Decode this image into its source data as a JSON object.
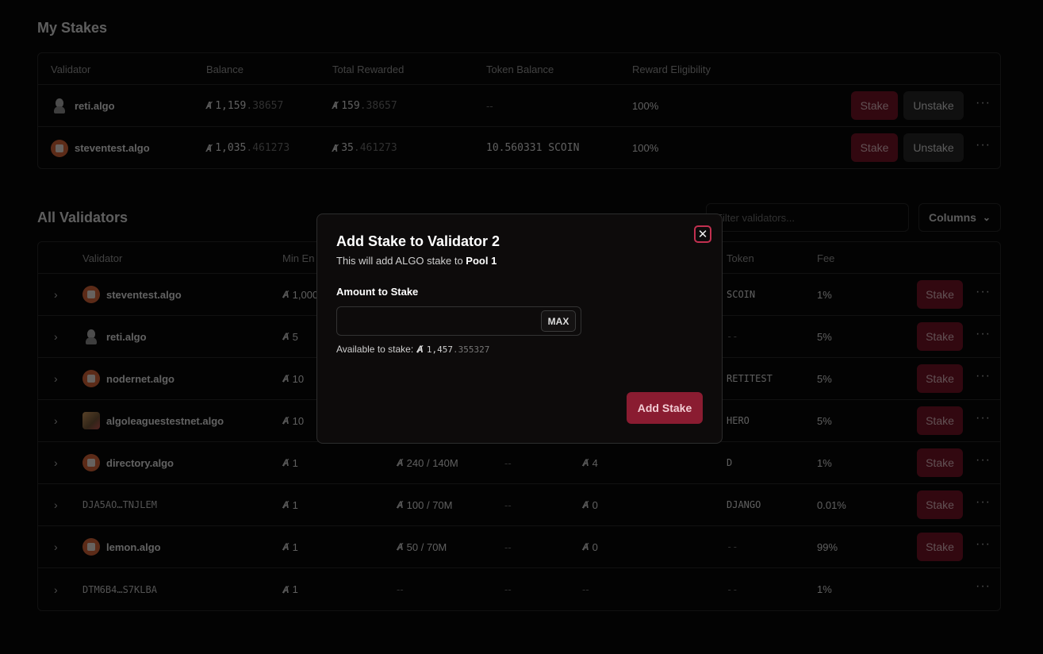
{
  "my_stakes": {
    "title": "My Stakes",
    "headers": [
      "Validator",
      "Balance",
      "Total Rewarded",
      "Token Balance",
      "Reward Eligibility"
    ],
    "rows": [
      {
        "validator": "reti.algo",
        "balance_int": "1,159",
        "balance_dec": ".38657",
        "rewarded_int": "159",
        "rewarded_dec": ".38657",
        "token_balance": "--",
        "eligibility": "100%",
        "stake_label": "Stake",
        "unstake_label": "Unstake",
        "more": "···"
      },
      {
        "validator": "steventest.algo",
        "balance_int": "1,035",
        "balance_dec": ".461273",
        "rewarded_int": "35",
        "rewarded_dec": ".461273",
        "token_balance": "10.560331 SCOIN",
        "eligibility": "100%",
        "stake_label": "Stake",
        "unstake_label": "Unstake",
        "more": "···"
      }
    ]
  },
  "all_validators": {
    "title": "All Validators",
    "filter_placeholder": "Filter validators...",
    "columns_label": "Columns",
    "headers": {
      "validator": "Validator",
      "min_entry": "Min En",
      "token": "Token",
      "fee": "Fee"
    },
    "rows": [
      {
        "validator": "steventest.algo",
        "min": "1,000",
        "stakers": "",
        "pools": "",
        "reward": "",
        "token": "SCOIN",
        "fee": "1%",
        "stake": "Stake"
      },
      {
        "validator": "reti.algo",
        "min": "5",
        "stakers": "",
        "pools": "",
        "reward": "",
        "token": "--",
        "fee": "5%",
        "stake": "Stake"
      },
      {
        "validator": "nodernet.algo",
        "min": "10",
        "stakers": "",
        "pools": "",
        "reward": "",
        "token": "RETITEST",
        "fee": "5%",
        "stake": "Stake"
      },
      {
        "validator": "algoleaguestestnet.algo",
        "min": "10",
        "stakers": "",
        "pools": "",
        "reward": "",
        "token": "HERO",
        "fee": "5%",
        "stake": "Stake"
      },
      {
        "validator": "directory.algo",
        "min": "1",
        "stakers": "240 / 140M",
        "pools": "--",
        "reward": "4",
        "token": "D",
        "fee": "1%",
        "stake": "Stake"
      },
      {
        "validator": "DJA5AO…TNJLEM",
        "min": "1",
        "stakers": "100 / 70M",
        "pools": "--",
        "reward": "0",
        "token": "DJANGO",
        "fee": "0.01%",
        "stake": "Stake"
      },
      {
        "validator": "lemon.algo",
        "min": "1",
        "stakers": "50 / 70M",
        "pools": "--",
        "reward": "0",
        "token": "--",
        "fee": "99%",
        "stake": "Stake"
      },
      {
        "validator": "DTM6B4…S7KLBA",
        "min": "1",
        "stakers": "--",
        "pools": "--",
        "reward": "--",
        "token": "--",
        "fee": "1%",
        "stake": ""
      }
    ]
  },
  "modal": {
    "title": "Add Stake to Validator 2",
    "desc_prefix": "This will add ALGO stake to ",
    "desc_pool": "Pool 1",
    "field_label": "Amount to Stake",
    "input_value": "",
    "max_label": "MAX",
    "available_label": "Available to stake:",
    "available_int": "1,457",
    "available_dec": ".355327",
    "submit_label": "Add Stake",
    "close_symbol": "✕"
  },
  "algo_symbol": "Ⱥ",
  "colors": {
    "accent": "#8a1c31",
    "background": "#030303",
    "close_ring": "#c23050"
  }
}
